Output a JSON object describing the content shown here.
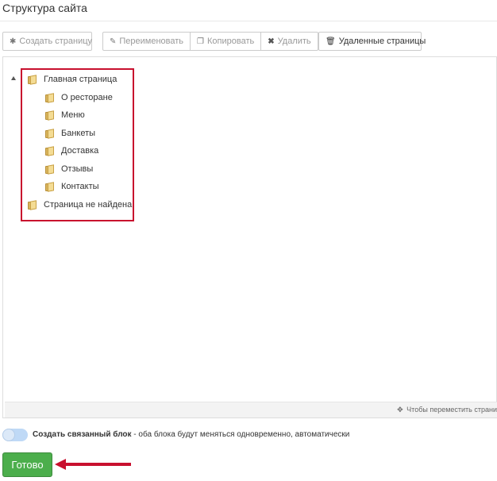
{
  "header": {
    "title": "Структура сайта"
  },
  "toolbar": {
    "create_label": "Создать страницу",
    "rename_label": "Переименовать",
    "copy_label": "Копировать",
    "delete_label": "Удалить",
    "deleted_pages_label": "Удаленные страницы"
  },
  "tree": {
    "root": "Главная страница",
    "children": [
      "О ресторане",
      "Меню",
      "Банкеты",
      "Доставка",
      "Отзывы",
      "Контакты"
    ],
    "other": "Страница не найдена"
  },
  "panel_footer": {
    "hint": "Чтобы переместить страни"
  },
  "linked_block": {
    "label_bold": "Создать связанный блок",
    "label_rest": " - оба блока будут меняться одновременно, автоматически"
  },
  "done_label": "Готово",
  "colors": {
    "highlight": "#c8102e",
    "done_button": "#4cae4c",
    "arrow": "#c8102e"
  }
}
